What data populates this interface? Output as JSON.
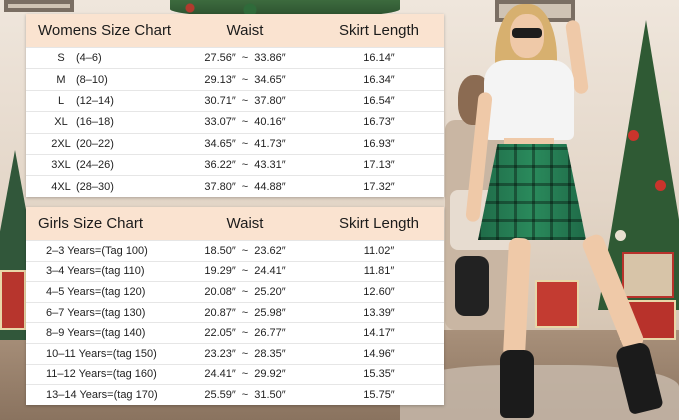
{
  "womens": {
    "headers": [
      "Womens Size Chart",
      "Waist",
      "Skirt Length"
    ],
    "rows": [
      {
        "size": "S",
        "range": "(4–6)",
        "waist_min": "27.56″",
        "waist_max": "33.86″",
        "length": "16.14″"
      },
      {
        "size": "M",
        "range": "(8–10)",
        "waist_min": "29.13″",
        "waist_max": "34.65″",
        "length": "16.34″"
      },
      {
        "size": "L",
        "range": "(12–14)",
        "waist_min": "30.71″",
        "waist_max": "37.80″",
        "length": "16.54″"
      },
      {
        "size": "XL",
        "range": "(16–18)",
        "waist_min": "33.07″",
        "waist_max": "40.16″",
        "length": "16.73″"
      },
      {
        "size": "2XL",
        "range": "(20–22)",
        "waist_min": "34.65″",
        "waist_max": "41.73″",
        "length": "16.93″"
      },
      {
        "size": "3XL",
        "range": "(24–26)",
        "waist_min": "36.22″",
        "waist_max": "43.31″",
        "length": "17.13″"
      },
      {
        "size": "4XL",
        "range": "(28–30)",
        "waist_min": "37.80″",
        "waist_max": "44.88″",
        "length": "17.32″"
      }
    ]
  },
  "girls": {
    "headers": [
      "Girls Size Chart",
      "Waist",
      "Skirt Length"
    ],
    "rows": [
      {
        "size": "2–3 Years=(Tag 100)",
        "waist_min": "18.50″",
        "waist_max": "23.62″",
        "length": "11.02″"
      },
      {
        "size": "3–4 Years=(tag 110)",
        "waist_min": "19.29″",
        "waist_max": "24.41″",
        "length": "11.81″"
      },
      {
        "size": "4–5 Years=(tag 120)",
        "waist_min": "20.08″",
        "waist_max": "25.20″",
        "length": "12.60″"
      },
      {
        "size": "6–7 Years=(tag 130)",
        "waist_min": "20.87″",
        "waist_max": "25.98″",
        "length": "13.39″"
      },
      {
        "size": "8–9 Years=(tag 140)",
        "waist_min": "22.05″",
        "waist_max": "26.77″",
        "length": "14.17″"
      },
      {
        "size": "10–11 Years=(tag 150)",
        "waist_min": "23.23″",
        "waist_max": "28.35″",
        "length": "14.96″"
      },
      {
        "size": "11–12 Years=(tag 160)",
        "waist_min": "24.41″",
        "waist_max": "29.92″",
        "length": "15.35″"
      },
      {
        "size": "13–14 Years=(tag 170)",
        "waist_min": "25.59″",
        "waist_max": "31.50″",
        "length": "15.75″"
      }
    ]
  },
  "separator": "~",
  "colors": {
    "header_bg": "#fae3d0",
    "skirt_green": "#2a8a5c"
  }
}
